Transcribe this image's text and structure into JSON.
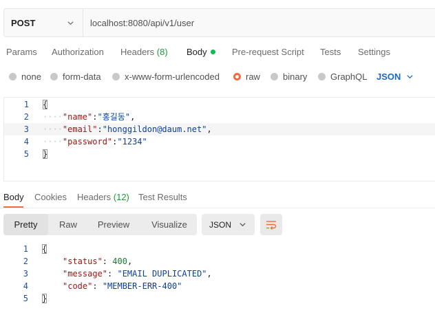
{
  "request": {
    "method": "POST",
    "url": "localhost:8080/api/v1/user"
  },
  "request_tabs": [
    {
      "label": "Params"
    },
    {
      "label": "Authorization"
    },
    {
      "label": "Headers",
      "count": "(8)"
    },
    {
      "label": "Body",
      "active": true
    },
    {
      "label": "Pre-request Script"
    },
    {
      "label": "Tests"
    },
    {
      "label": "Settings"
    }
  ],
  "body_types": [
    "none",
    "form-data",
    "x-www-form-urlencoded",
    "raw",
    "binary",
    "GraphQL"
  ],
  "body_type_selected": "raw",
  "body_language": "JSON",
  "request_body": {
    "line_numbers": [
      "1",
      "2",
      "3",
      "4",
      "5"
    ],
    "open": "{",
    "close": "}",
    "indent": "····",
    "fields": [
      {
        "key": "\"name\"",
        "value": "\"홍길동\"",
        "sep": ","
      },
      {
        "key": "\"email\"",
        "value": "\"honggildon@daum.net\"",
        "sep": ","
      },
      {
        "key": "\"password\"",
        "value": "\"1234\"",
        "sep": ""
      }
    ]
  },
  "response_tabs": [
    {
      "label": "Body",
      "active": true
    },
    {
      "label": "Cookies"
    },
    {
      "label": "Headers",
      "count": "(12)"
    },
    {
      "label": "Test Results"
    }
  ],
  "response_views": [
    "Pretty",
    "Raw",
    "Preview",
    "Visualize"
  ],
  "response_view_selected": "Pretty",
  "response_format": "JSON",
  "response_body": {
    "line_numbers": [
      "1",
      "2",
      "3",
      "4",
      "5"
    ],
    "open": "{",
    "close": "}",
    "fields": [
      {
        "key": "\"status\"",
        "value": "400",
        "type": "number",
        "sep": ","
      },
      {
        "key": "\"message\"",
        "value": "\"EMAIL DUPLICATED\"",
        "type": "string",
        "sep": ","
      },
      {
        "key": "\"code\"",
        "value": "\"MEMBER-ERR-400\"",
        "type": "string",
        "sep": ""
      }
    ]
  },
  "colors": {
    "accent": "#f26b3a",
    "link_blue": "#1769c8",
    "count_green": "#1a9b3b"
  }
}
